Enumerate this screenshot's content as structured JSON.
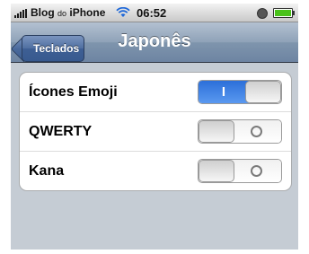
{
  "status_bar": {
    "carrier": "Blog",
    "carrier_small": "do",
    "carrier_suffix": "iPhone",
    "time": "06:52",
    "battery_color": "#49c21a"
  },
  "nav": {
    "back_label": "Teclados",
    "title": "Japonês"
  },
  "settings": [
    {
      "label": "Ícones Emoji",
      "state": "on",
      "on_text": "I"
    },
    {
      "label": "QWERTY",
      "state": "off"
    },
    {
      "label": "Kana",
      "state": "off"
    }
  ],
  "colors": {
    "switch_on": "#2c6fd9",
    "nav_bar": "#6d84a2",
    "background": "#c5ccd4"
  }
}
